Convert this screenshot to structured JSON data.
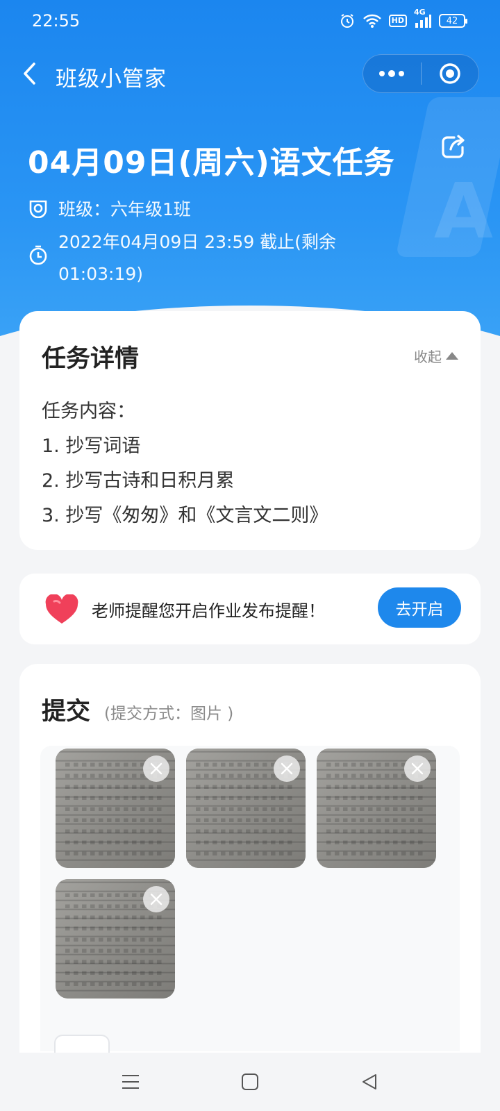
{
  "status_bar": {
    "time": "22:55",
    "battery": "42",
    "network": "4G",
    "hd": "HD"
  },
  "nav": {
    "title": "班级小管家"
  },
  "task": {
    "title": "04月09日(周六)语文任务",
    "class_label": "班级：六年级1班",
    "deadline": "2022年04月09日 23:59 截止(剩余 01:03:19)"
  },
  "detail": {
    "title": "任务详情",
    "collapse_label": "收起",
    "lines": [
      "任务内容：",
      "1. 抄写词语",
      "2. 抄写古诗和日积月累",
      "3. 抄写《匆匆》和《文言文二则》"
    ]
  },
  "reminder": {
    "text": "老师提醒您开启作业发布提醒！",
    "button": "去开启"
  },
  "submit": {
    "title": "提交",
    "subtitle": "(提交方式：图片 )",
    "photo_count": 4
  },
  "colors": {
    "primary": "#1e88ec",
    "heart": "#f0405a"
  },
  "icons": [
    "back-arrow-icon",
    "more-icon",
    "target-icon",
    "share-icon",
    "class-icon",
    "clock-icon",
    "heart-icon",
    "close-icon",
    "menu-icon",
    "home-icon",
    "back-triangle-icon"
  ]
}
